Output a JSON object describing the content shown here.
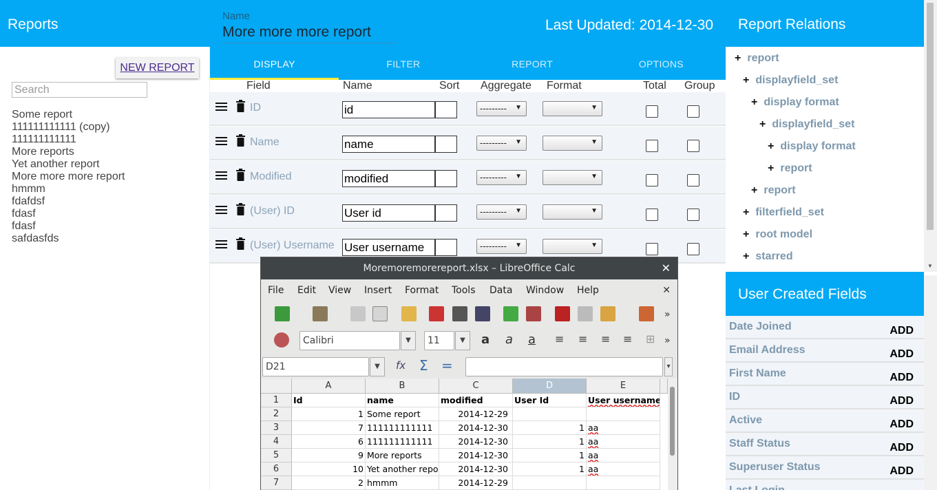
{
  "left": {
    "title": "Reports",
    "new_report_label": "NEW REPORT",
    "search_placeholder": "Search",
    "reports": [
      "Some report",
      "111111111111 (copy)",
      "111111111111",
      "More reports",
      "Yet another report",
      "More more more report",
      "hmmm",
      "fdafdsf",
      "fdasf",
      "fdasf",
      "safdasfds"
    ]
  },
  "editor": {
    "name_caption": "Name",
    "name_value": "More more more report",
    "last_updated": "Last Updated: 2014-12-30",
    "tabs": [
      "DISPLAY",
      "FILTER",
      "REPORT",
      "OPTIONS"
    ],
    "active_tab": "DISPLAY",
    "columns": [
      "Field",
      "Name",
      "Sort",
      "Aggregate",
      "Format",
      "Total",
      "Group"
    ],
    "aggregate_placeholder": "---------",
    "rows": [
      {
        "field": "ID",
        "name": "id"
      },
      {
        "field": "Name",
        "name": "name"
      },
      {
        "field": "Modified",
        "name": "modified"
      },
      {
        "field": "(User) ID",
        "name": "User id"
      },
      {
        "field": "(User) Username",
        "name": "User username"
      }
    ]
  },
  "relations": {
    "title": "Report Relations",
    "tree": [
      {
        "label": "report",
        "depth": 0
      },
      {
        "label": "displayfield_set",
        "depth": 1
      },
      {
        "label": "display format",
        "depth": 2
      },
      {
        "label": "displayfield_set",
        "depth": 3
      },
      {
        "label": "display format",
        "depth": 4
      },
      {
        "label": "report",
        "depth": 4
      },
      {
        "label": "report",
        "depth": 2
      },
      {
        "label": "filterfield_set",
        "depth": 1
      },
      {
        "label": "root model",
        "depth": 1
      },
      {
        "label": "starred",
        "depth": 1
      }
    ]
  },
  "user_fields": {
    "title": "User Created Fields",
    "add_label": "ADD",
    "items": [
      "Date Joined",
      "Email Address",
      "First Name",
      "ID",
      "Active",
      "Staff Status",
      "Superuser Status",
      "Last Login"
    ]
  },
  "calc": {
    "title": "Moremoremorereport.xlsx – LibreOffice Calc",
    "menus": [
      "File",
      "Edit",
      "View",
      "Insert",
      "Format",
      "Tools",
      "Data",
      "Window",
      "Help"
    ],
    "font_name": "Calibri",
    "font_size": "11",
    "cell_ref": "D21",
    "columns": [
      "A",
      "B",
      "C",
      "D",
      "E"
    ],
    "selected_column": "D",
    "rows": [
      {
        "n": "1",
        "a": "Id",
        "b": "name",
        "c": "modified",
        "d": "User Id",
        "e": "User username"
      },
      {
        "n": "2",
        "a": "1",
        "b": "Some report",
        "c": "2014-12-29",
        "d": "",
        "e": ""
      },
      {
        "n": "3",
        "a": "7",
        "b": "111111111111",
        "c": "2014-12-30",
        "d": "1",
        "e": "aa"
      },
      {
        "n": "4",
        "a": "6",
        "b": "111111111111",
        "c": "2014-12-30",
        "d": "1",
        "e": "aa"
      },
      {
        "n": "5",
        "a": "9",
        "b": "More reports",
        "c": "2014-12-30",
        "d": "1",
        "e": "aa"
      },
      {
        "n": "6",
        "a": "10",
        "b": "Yet another report",
        "c": "2014-12-30",
        "d": "1",
        "e": "aa"
      },
      {
        "n": "7",
        "a": "2",
        "b": "hmmm",
        "c": "2014-12-29",
        "d": "",
        "e": ""
      }
    ]
  },
  "colors": {
    "accent": "#03A9F4",
    "tab_indicator": "#FFEB3B",
    "field_label": "#8CA3B8"
  }
}
